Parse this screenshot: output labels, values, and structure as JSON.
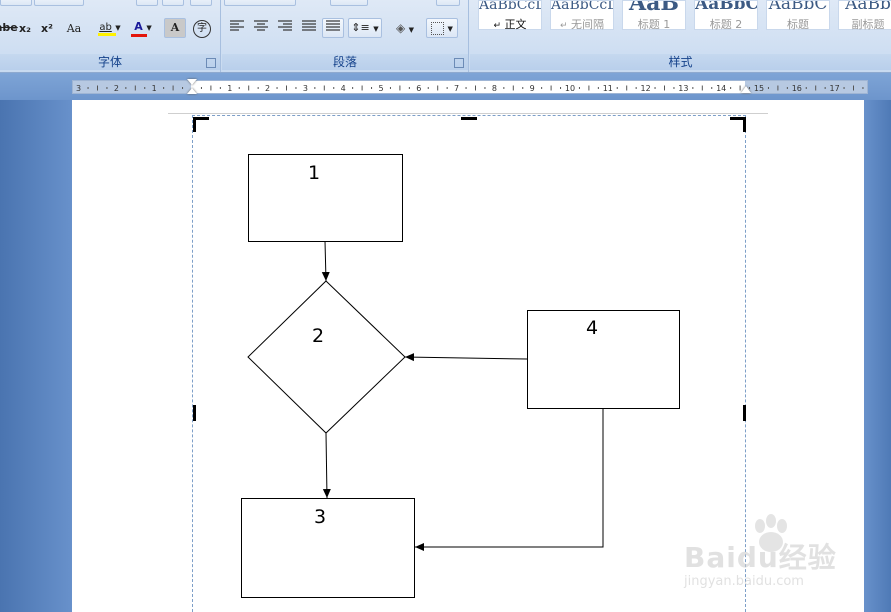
{
  "ribbon": {
    "groups": {
      "font": {
        "label": "字体"
      },
      "paragraph": {
        "label": "段落"
      },
      "styles": {
        "label": "样式"
      }
    },
    "font_buttons": {
      "strikethrough": "abe",
      "subscript": "x₂",
      "superscript": "x²",
      "change_case": "Aa",
      "highlight": "ab",
      "font_color": "A",
      "char_shading": "A",
      "enclose": "字"
    },
    "colors": {
      "font_color_bar": "#e3160b",
      "highlight_bar": "#fff200",
      "ribbon_text": "#15428b"
    },
    "styles": [
      {
        "preview": "AaBbCcD",
        "name": "正文",
        "marker": "↵",
        "active": true
      },
      {
        "preview": "AaBbCcD",
        "name": "无间隔",
        "marker": "↵",
        "active": false
      },
      {
        "preview": "AaB",
        "name": "标题 1",
        "marker": "",
        "active": false
      },
      {
        "preview": "AaBbC",
        "name": "标题 2",
        "marker": "",
        "active": false
      },
      {
        "preview": "AaBbC",
        "name": "标题",
        "marker": "",
        "active": false
      },
      {
        "preview": "AaBb",
        "name": "副标题",
        "marker": "",
        "active": false
      }
    ]
  },
  "ruler": {
    "left_numbers": [
      "3",
      "2",
      "1"
    ],
    "right_numbers": [
      "1",
      "2",
      "3",
      "4",
      "5",
      "6",
      "7",
      "8",
      "9",
      "10",
      "11",
      "12",
      "13",
      "14",
      "15",
      "16",
      "17"
    ]
  },
  "diagram": {
    "shapes": [
      {
        "id": "box1",
        "label": "1"
      },
      {
        "id": "diamond2",
        "label": "2"
      },
      {
        "id": "box3",
        "label": "3"
      },
      {
        "id": "box4",
        "label": "4"
      }
    ]
  },
  "watermark": {
    "main": "Baidu经验",
    "sub": "jingyan.baidu.com"
  }
}
